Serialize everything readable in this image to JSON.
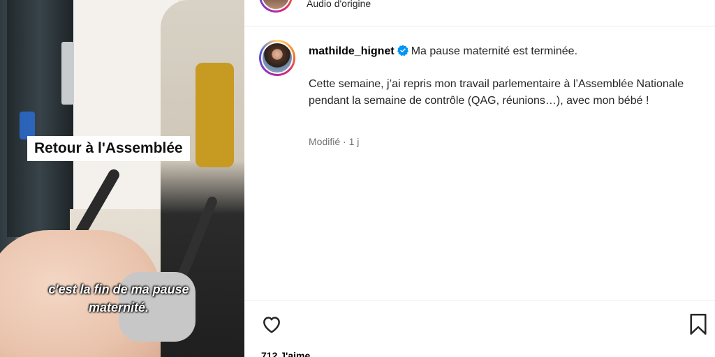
{
  "media": {
    "overlay_label": "Retour à l'Assemblée",
    "subtitle": "c'est la fin de ma pause maternité."
  },
  "top": {
    "audio_label": "Audio d'origine"
  },
  "post": {
    "username": "mathilde_hignet",
    "verified_icon": "verified-badge-icon",
    "caption_first": "Ma pause maternité est terminée.",
    "caption_body": "Cette semaine, j’ai repris mon travail parlementaire à l’Assemblée Nationale pendant la semaine de contrôle (QAG, réunions…), avec mon bébé !",
    "edited": "Modifié",
    "separator": "·",
    "age": "1 j"
  },
  "actions": {
    "like_icon": "heart-icon",
    "save_icon": "bookmark-icon",
    "likes_partial": "712 J'aime"
  },
  "colors": {
    "verified_blue": "#0095f6",
    "meta_gray": "#737373",
    "text": "#262626"
  }
}
